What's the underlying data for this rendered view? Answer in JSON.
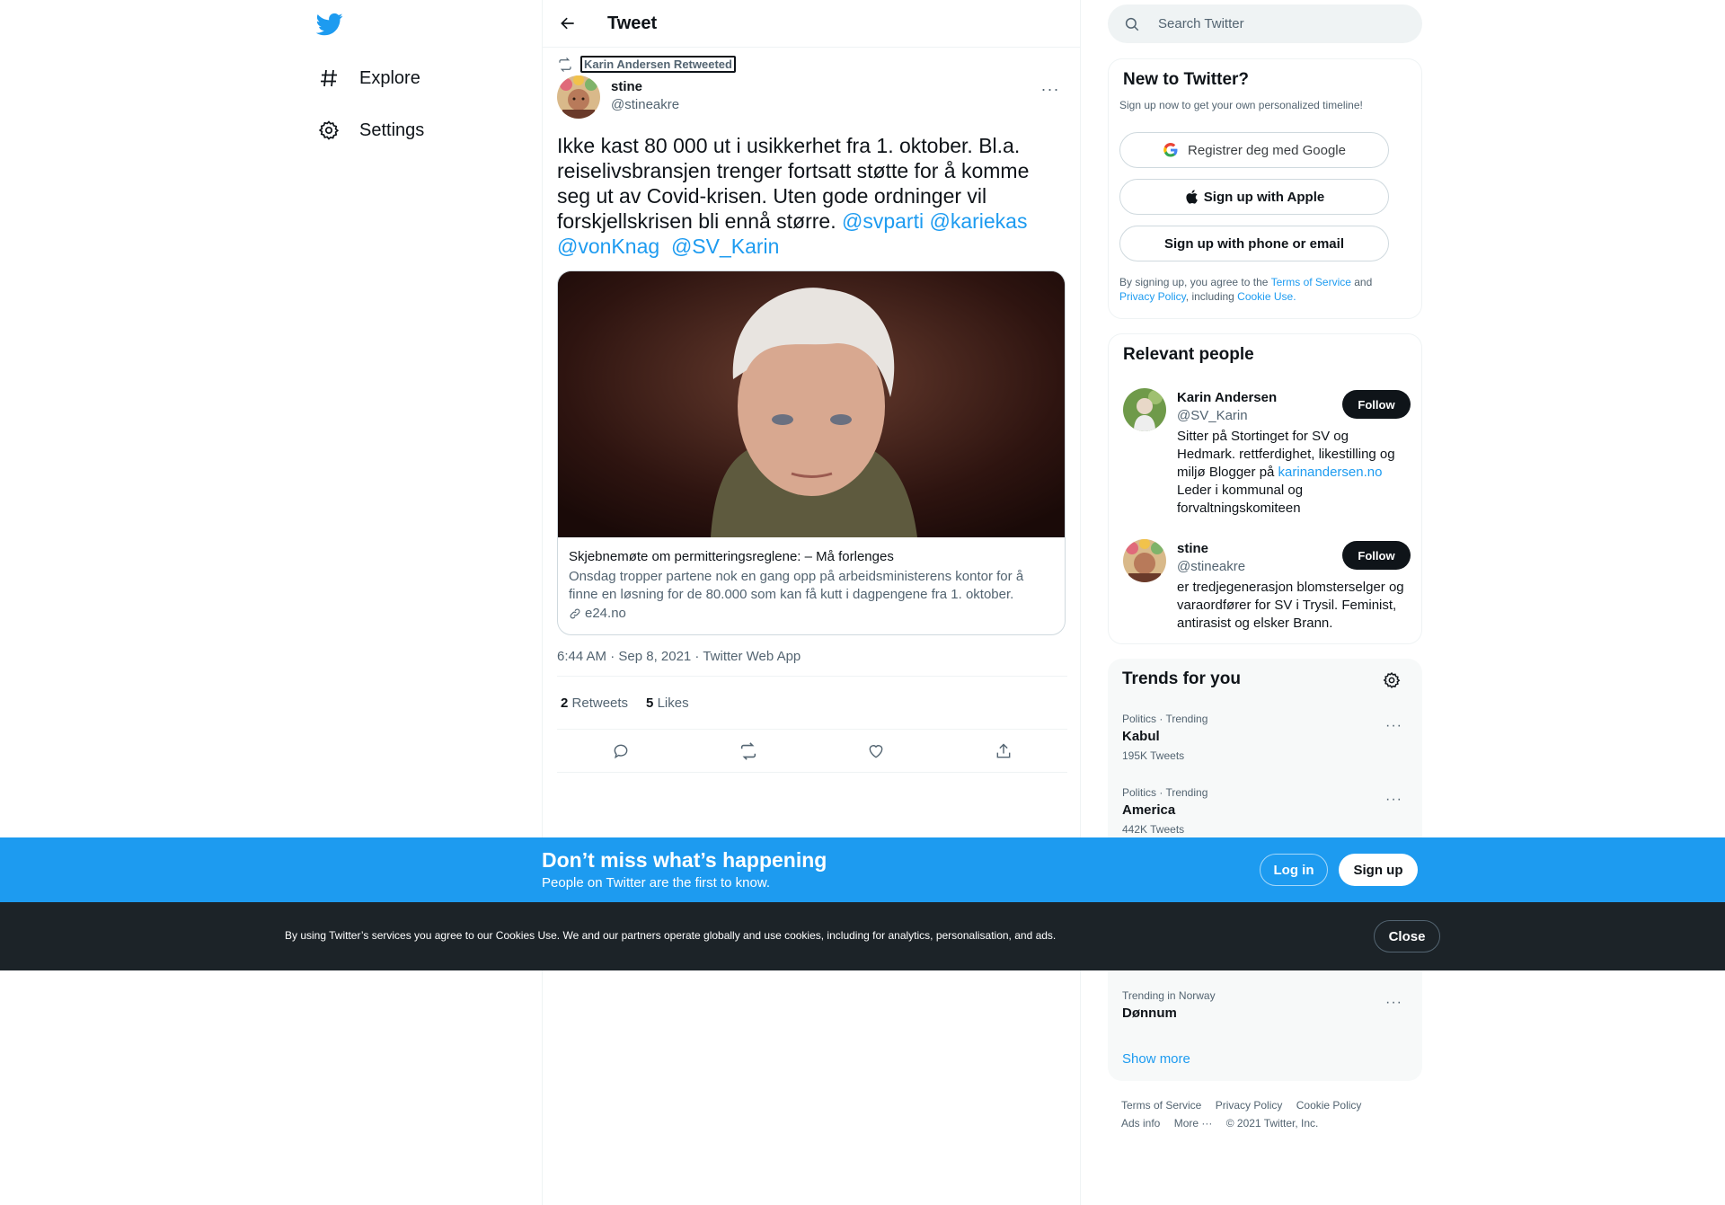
{
  "nav": {
    "logo": "twitter-bird-icon",
    "items": [
      {
        "label": "Explore",
        "icon": "hashtag-icon"
      },
      {
        "label": "Settings",
        "icon": "gear-icon"
      }
    ]
  },
  "header": {
    "title": "Tweet"
  },
  "tweet": {
    "retweeted_by": "Karin Andersen Retweeted",
    "author_name": "stine",
    "author_handle": "@stineakre",
    "text_plain": "Ikke kast 80 000 ut i usikkerhet fra 1. oktober. Bl.a. reiselivsbransjen trenger fortsatt støtte for å komme seg ut av Covid-krisen. Uten gode ordninger vil forskjellskrisen bli ennå større.",
    "mentions": [
      "@svparti",
      "@kariekas",
      "@vonKnag",
      "@SV_Karin"
    ],
    "card": {
      "title": "Skjebnemøte om permitteringsreglene: – Må forlenges",
      "description": "Onsdag tropper partene nok en gang opp på arbeidsministerens kontor for å finne en løsning for de 80.000 som kan få kutt i dagpengene fra 1. oktober.",
      "domain": "e24.no"
    },
    "timestamp": "6:44 AM · Sep 8, 2021 · Twitter Web App",
    "retweets_count": "2",
    "retweets_label": "Retweets",
    "likes_count": "5",
    "likes_label": "Likes"
  },
  "search": {
    "placeholder": "Search Twitter"
  },
  "new_to_twitter": {
    "title": "New to Twitter?",
    "subtitle": "Sign up now to get your own personalized timeline!",
    "google_btn": "Registrer deg med Google",
    "apple_btn": "Sign up with Apple",
    "phone_btn": "Sign up with phone or email",
    "legal_1": "By signing up, you agree to the ",
    "tos": "Terms of Service",
    "legal_2": " and ",
    "privacy": "Privacy Policy",
    "legal_3": ", including ",
    "cookie": "Cookie Use."
  },
  "relevant_people": {
    "title": "Relevant people",
    "people": [
      {
        "name": "Karin Andersen",
        "handle": "@SV_Karin",
        "follow": "Follow",
        "bio_1": "Sitter på Stortinget for SV og Hedmark. rettferdighet, likestilling og miljø Blogger på ",
        "bio_link": "karinandersen.no",
        "bio_2": " Leder i kommunal og forvaltningskomiteen"
      },
      {
        "name": "stine",
        "handle": "@stineakre",
        "follow": "Follow",
        "bio_1": "er tredjegenerasjon blomsterselger og varaordfører for SV i Trysil. Feminist, antirasist og elsker Brann."
      }
    ]
  },
  "trends": {
    "title": "Trends for you",
    "items": [
      {
        "category": "Politics · Trending",
        "name": "Kabul",
        "count": "195K Tweets"
      },
      {
        "category": "Politics · Trending",
        "name": "America",
        "count": "442K Tweets"
      },
      {
        "category": "Trending in Norway",
        "name": "Dønnum",
        "count": ""
      }
    ],
    "show_more": "Show more"
  },
  "footer": {
    "links": [
      "Terms of Service",
      "Privacy Policy",
      "Cookie Policy",
      "Ads info",
      "More ···"
    ],
    "copyright": "© 2021 Twitter, Inc."
  },
  "banner": {
    "title": "Don’t miss what’s happening",
    "subtitle": "People on Twitter are the first to know.",
    "login": "Log in",
    "signup": "Sign up"
  },
  "cookies": {
    "text": "By using Twitter’s services you agree to our Cookies Use. We and our partners operate globally and use cookies, including for analytics, personalisation, and ads.",
    "close": "Close"
  },
  "colors": {
    "accent": "#1d9bf0",
    "text": "#0f1419",
    "muted": "#536471",
    "cookie_bg": "#1c2328"
  }
}
